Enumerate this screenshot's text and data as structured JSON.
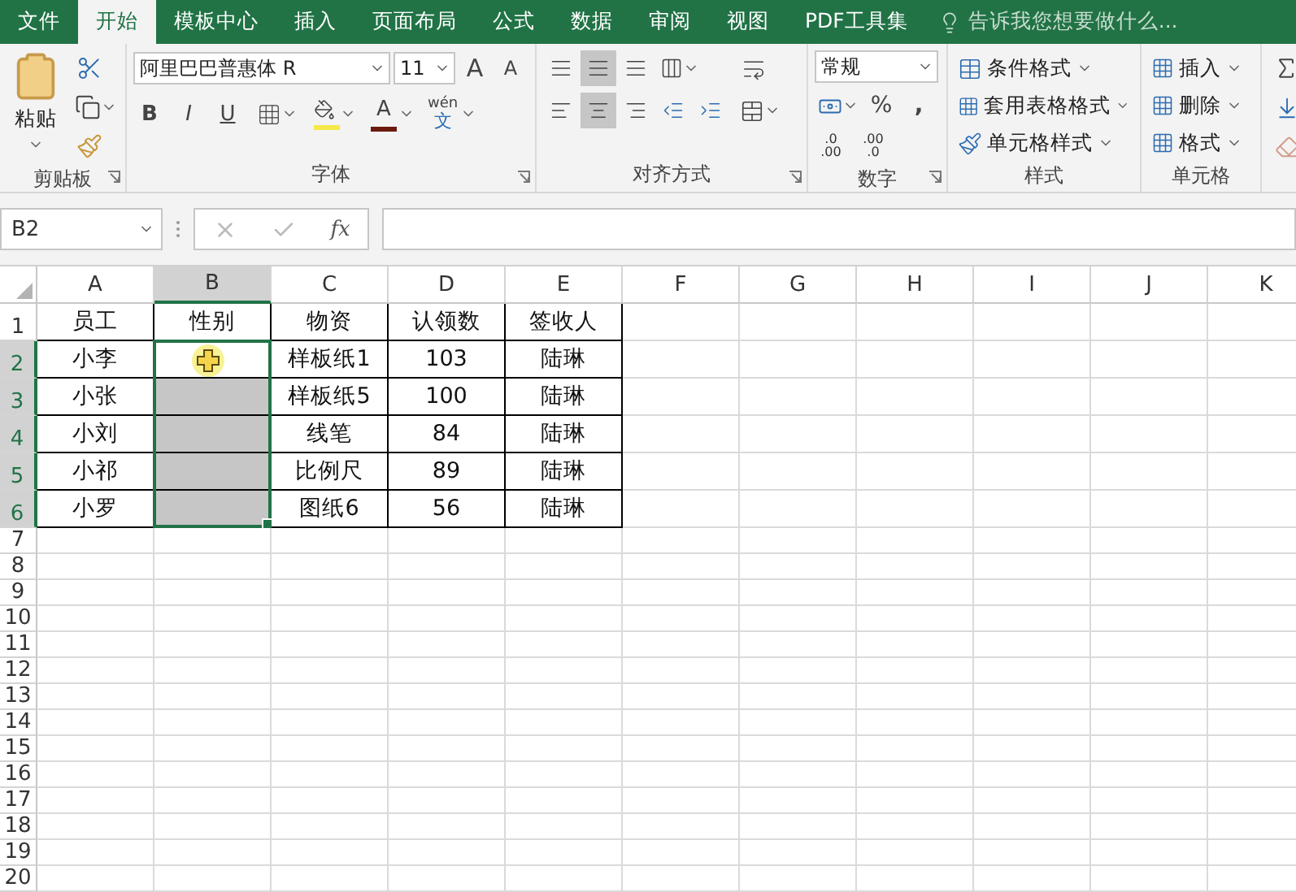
{
  "tabs": [
    {
      "label": "文件",
      "selected": false
    },
    {
      "label": "开始",
      "selected": true
    },
    {
      "label": "模板中心",
      "selected": false
    },
    {
      "label": "插入",
      "selected": false
    },
    {
      "label": "页面布局",
      "selected": false
    },
    {
      "label": "公式",
      "selected": false
    },
    {
      "label": "数据",
      "selected": false
    },
    {
      "label": "审阅",
      "selected": false
    },
    {
      "label": "视图",
      "selected": false
    },
    {
      "label": "PDF工具集",
      "selected": false
    }
  ],
  "tell_me": {
    "placeholder": "告诉我您想要做什么..."
  },
  "ribbon": {
    "clipboard": {
      "paste": "粘贴",
      "label": "剪贴板"
    },
    "font": {
      "name": "阿里巴巴普惠体 R",
      "size": "11",
      "grow": "A",
      "shrink": "A",
      "bold": "B",
      "italic": "I",
      "underline": "U",
      "font_color": "A",
      "phonetic": "wén",
      "phonetic_char": "文",
      "label": "字体"
    },
    "alignment": {
      "vertical": [
        {
          "selected": false
        },
        {
          "selected": true
        },
        {
          "selected": false
        }
      ],
      "horizontal": [
        {
          "selected": false
        },
        {
          "selected": true
        },
        {
          "selected": false
        }
      ],
      "label": "对齐方式"
    },
    "number": {
      "format": "常规",
      "percent": "%",
      "comma": ",",
      "increase_decimal": [
        ".0",
        ".00"
      ],
      "decrease_decimal": [
        ".00",
        ".0"
      ],
      "label": "数字"
    },
    "styles": {
      "items": [
        "条件格式",
        "套用表格格式",
        "单元格样式"
      ],
      "label": "样式"
    },
    "cells": {
      "items": [
        "插入",
        "删除",
        "格式"
      ],
      "label": "单元格"
    }
  },
  "name_box": "B2",
  "formula": {
    "fx": "fx"
  },
  "columns": [
    {
      "label": "A",
      "selected": false
    },
    {
      "label": "B",
      "selected": true
    },
    {
      "label": "C",
      "selected": false
    },
    {
      "label": "D",
      "selected": false
    },
    {
      "label": "E",
      "selected": false
    },
    {
      "label": "F",
      "selected": false
    },
    {
      "label": "G",
      "selected": false
    },
    {
      "label": "H",
      "selected": false
    },
    {
      "label": "I",
      "selected": false
    },
    {
      "label": "J",
      "selected": false
    },
    {
      "label": "K",
      "selected": false
    }
  ],
  "rows": [
    {
      "label": "1",
      "selected": false,
      "cells": [
        {
          "text": "员工",
          "selected": false
        },
        {
          "text": "性别",
          "selected": false
        },
        {
          "text": "物资",
          "selected": false
        },
        {
          "text": "认领数",
          "selected": false
        },
        {
          "text": "签收人",
          "selected": false
        }
      ]
    },
    {
      "label": "2",
      "selected": true,
      "cells": [
        {
          "text": "小李",
          "selected": false
        },
        {
          "selected": true,
          "active": true
        },
        {
          "text": "样板纸1",
          "selected": false
        },
        {
          "text": "103",
          "selected": false
        },
        {
          "text": "陆琳",
          "selected": false
        }
      ]
    },
    {
      "label": "3",
      "selected": true,
      "cells": [
        {
          "text": "小张",
          "selected": false
        },
        {
          "selected": true,
          "active": false
        },
        {
          "text": "样板纸5",
          "selected": false
        },
        {
          "text": "100",
          "selected": false
        },
        {
          "text": "陆琳",
          "selected": false
        }
      ]
    },
    {
      "label": "4",
      "selected": true,
      "cells": [
        {
          "text": "小刘",
          "selected": false
        },
        {
          "selected": true,
          "active": false
        },
        {
          "text": "线笔",
          "selected": false
        },
        {
          "text": "84",
          "selected": false
        },
        {
          "text": "陆琳",
          "selected": false
        }
      ]
    },
    {
      "label": "5",
      "selected": true,
      "cells": [
        {
          "text": "小祁",
          "selected": false
        },
        {
          "selected": true,
          "active": false
        },
        {
          "text": "比例尺",
          "selected": false
        },
        {
          "text": "89",
          "selected": false
        },
        {
          "text": "陆琳",
          "selected": false
        }
      ]
    },
    {
      "label": "6",
      "selected": true,
      "cells": [
        {
          "text": "小罗",
          "selected": false
        },
        {
          "selected": true,
          "active": false
        },
        {
          "text": "图纸6",
          "selected": false
        },
        {
          "text": "56",
          "selected": false
        },
        {
          "text": "陆琳",
          "selected": false
        }
      ]
    },
    {
      "label": "7",
      "selected": false
    },
    {
      "label": "8",
      "selected": false
    },
    {
      "label": "9",
      "selected": false
    },
    {
      "label": "10",
      "selected": false
    },
    {
      "label": "11",
      "selected": false
    },
    {
      "label": "12",
      "selected": false
    },
    {
      "label": "13",
      "selected": false
    },
    {
      "label": "14",
      "selected": false
    },
    {
      "label": "15",
      "selected": false
    },
    {
      "label": "16",
      "selected": false
    },
    {
      "label": "17",
      "selected": false
    },
    {
      "label": "18",
      "selected": false
    },
    {
      "label": "19",
      "selected": false
    },
    {
      "label": "20",
      "selected": false
    }
  ]
}
